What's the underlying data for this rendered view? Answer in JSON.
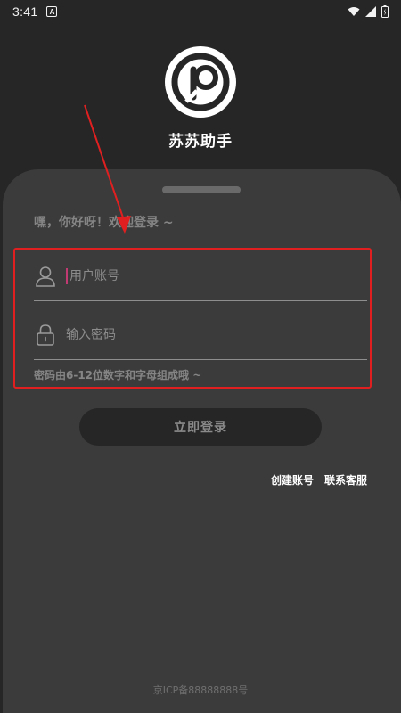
{
  "status_bar": {
    "time": "3:41",
    "app_icon_letter": "A",
    "icons": [
      "wifi-icon",
      "signal-icon",
      "battery-icon"
    ]
  },
  "app": {
    "name": "苏苏助手",
    "logo_icon": "p-logo-icon"
  },
  "login": {
    "welcome": "嘿，你好呀！欢迎登录 ~",
    "account_placeholder": "用户账号",
    "password_placeholder": "输入密码",
    "password_hint": "密码由6-12位数字和字母组成哦 ~",
    "submit_label": "立即登录",
    "create_account": "创建账号",
    "contact_support": "联系客服"
  },
  "footer": {
    "icp": "京ICP备88888888号"
  },
  "colors": {
    "background": "#262626",
    "sheet": "#3b3b3b",
    "annotation_red": "#e02020",
    "caret": "#c23a72"
  }
}
